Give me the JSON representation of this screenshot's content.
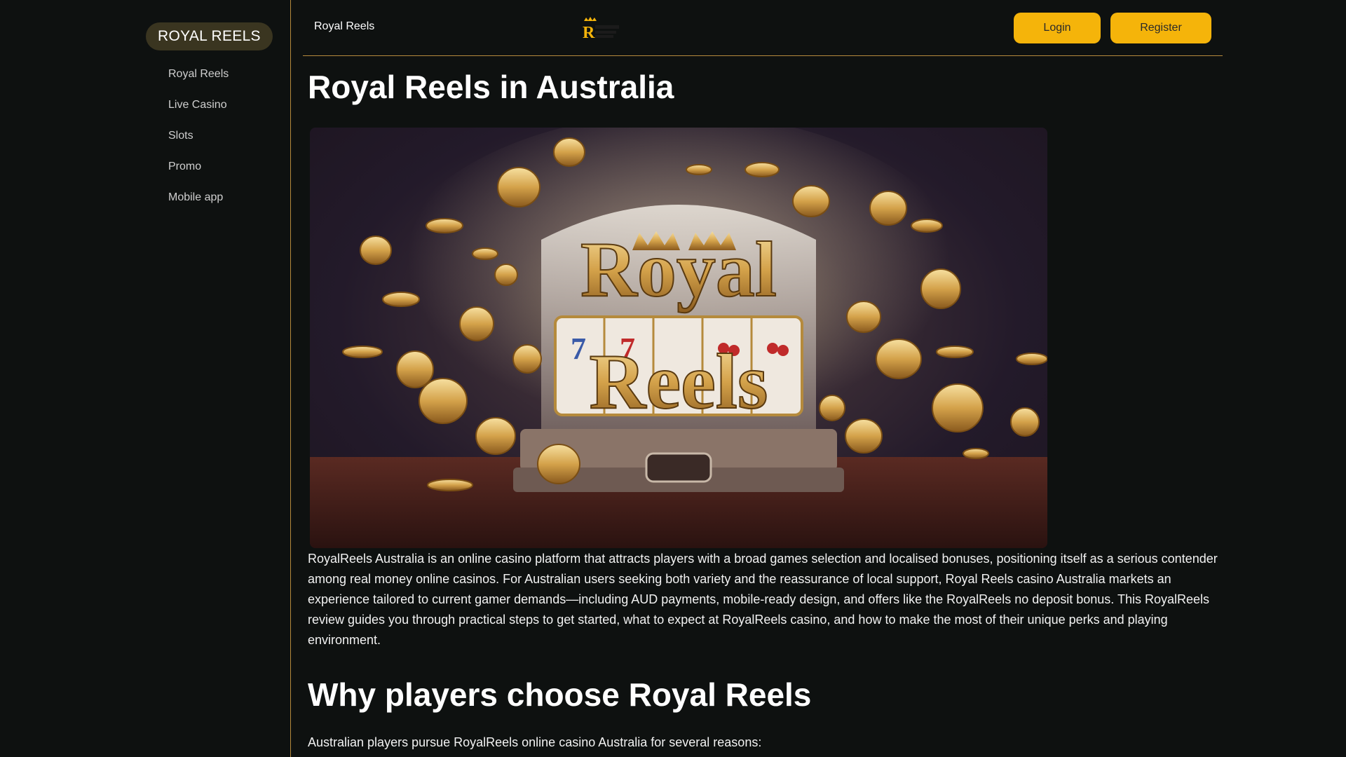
{
  "sidebar": {
    "brand": "ROYAL REELS",
    "items": [
      {
        "label": "Royal Reels"
      },
      {
        "label": "Live Casino"
      },
      {
        "label": "Slots"
      },
      {
        "label": "Promo"
      },
      {
        "label": "Mobile app"
      }
    ]
  },
  "header": {
    "title": "Royal Reels",
    "logo_icon": "royal-reels-logo-icon",
    "login_label": "Login",
    "register_label": "Register"
  },
  "main": {
    "heading": "Royal Reels in Australia",
    "hero_icon": "slot-machine-coins-image",
    "hero_text_line1": "Royal",
    "hero_text_line2": "Reels",
    "paragraph": "RoyalReels Australia is an online casino platform that attracts players with a broad games selection and localised bonuses, positioning itself as a serious contender among real money online casinos. For Australian users seeking both variety and the reassurance of local support, Royal Reels casino Australia markets an experience tailored to current gamer demands—including AUD payments, mobile-ready design, and offers like the RoyalReels no deposit bonus. This RoyalReels review guides you through practical steps to get started, what to expect at RoyalReels casino, and how to make the most of their unique perks and playing environment.",
    "section_heading": "Why players choose Royal Reels",
    "section_intro": "Australian players pursue RoyalReels online casino Australia for several reasons:"
  },
  "colors": {
    "background": "#0e1110",
    "accent": "#f5b40a",
    "divider": "#b58a3c",
    "brand_pill": "#3a3520"
  }
}
